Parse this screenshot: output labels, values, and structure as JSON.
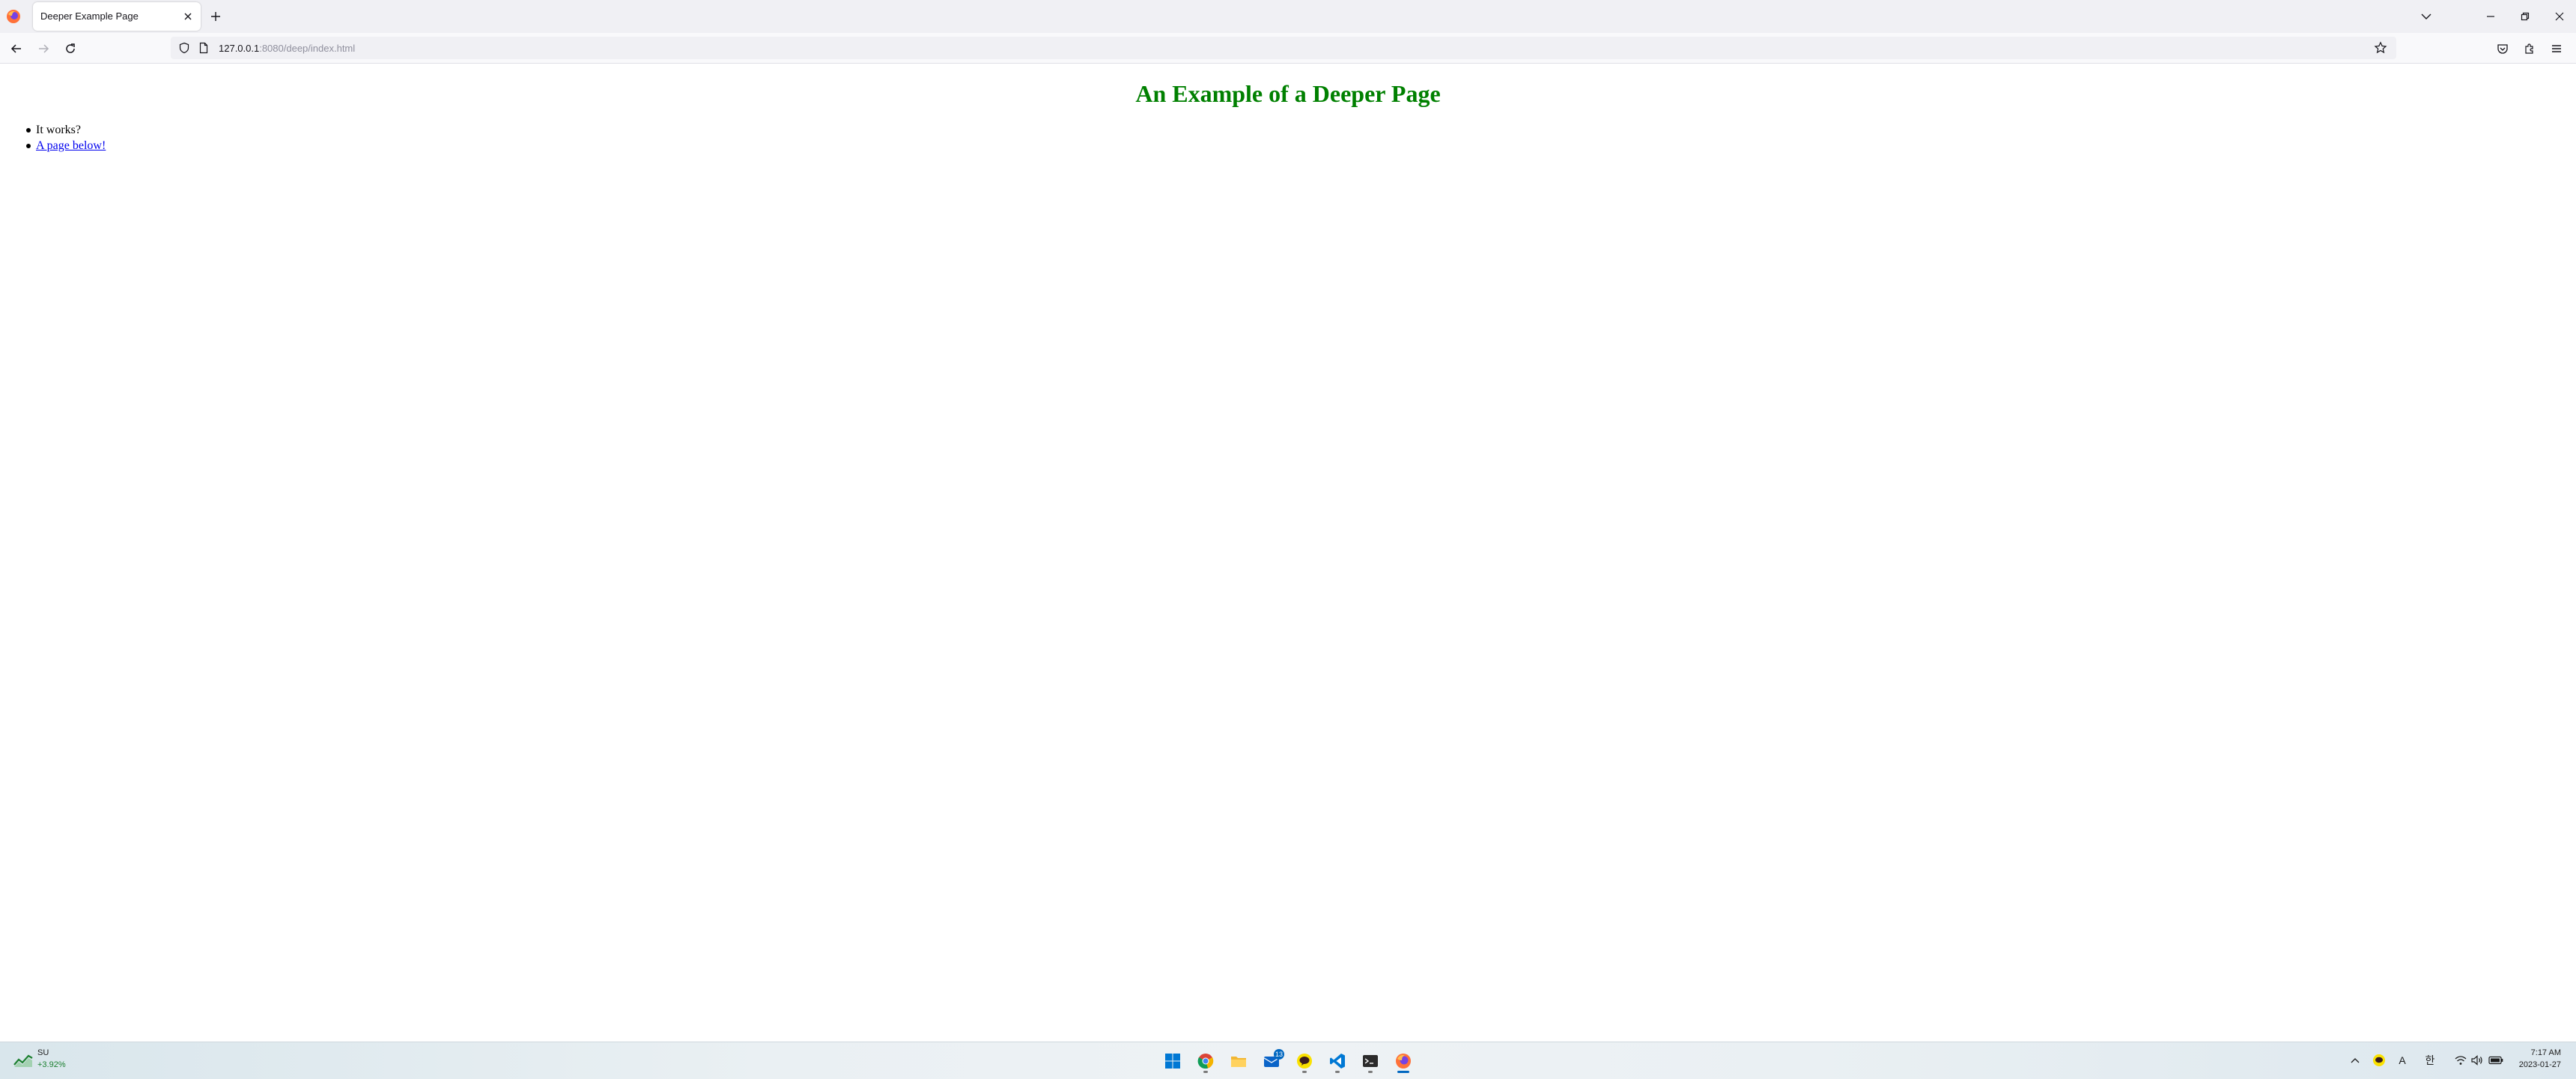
{
  "browser": {
    "tab": {
      "title": "Deeper Example Page"
    },
    "url": {
      "host": "127.0.0.1",
      "rest": ":8080/deep/index.html"
    }
  },
  "page": {
    "heading": "An Example of a Deeper Page",
    "heading_color": "#008000",
    "items": [
      {
        "text": "It works?"
      },
      {
        "text": "A page below!",
        "is_link": true
      }
    ]
  },
  "taskbar": {
    "weather": {
      "label": "SU",
      "change": "+3.92%"
    },
    "apps": [
      {
        "name": "start-menu-icon"
      },
      {
        "name": "chrome-icon"
      },
      {
        "name": "file-explorer-icon"
      },
      {
        "name": "mail-icon",
        "badge": "13"
      },
      {
        "name": "kakaotalk-icon"
      },
      {
        "name": "vscode-icon"
      },
      {
        "name": "terminal-icon"
      },
      {
        "name": "firefox-icon",
        "active": true
      }
    ],
    "tray": {
      "ime_letter": "A",
      "ime_korean": "한"
    },
    "clock": {
      "time": "7:17 AM",
      "date": "2023-01-27"
    }
  }
}
